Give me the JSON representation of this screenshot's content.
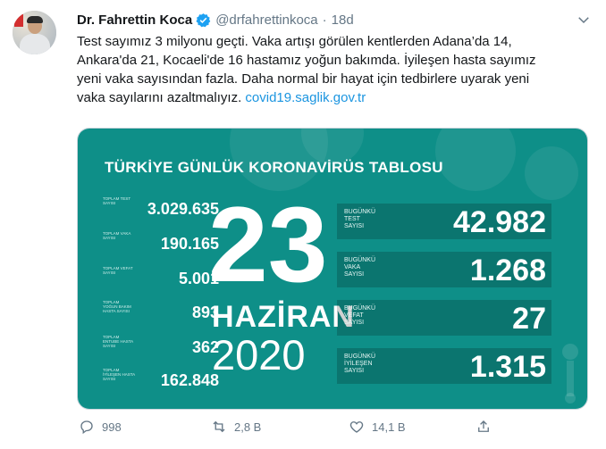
{
  "tweet": {
    "author": "Dr. Fahrettin Koca",
    "handle": "@drfahrettinkoca",
    "separator": "·",
    "time": "18d",
    "text_line1": "Test sayımız 3 milyonu geçti. Vaka artışı görülen kentlerden Adana’da 14,",
    "text_line2": "Ankara'da 21, Kocaeli'de 16 hastamız yoğun bakımda. İyileşen hasta sayımız",
    "text_line3": "yeni vaka sayısından fazla. Daha normal bir hayat için tedbirlere uyarak yeni",
    "text_line4_pre": "vaka sayılarını azaltmalıyız. ",
    "link": "covid19.saglik.gov.tr"
  },
  "image": {
    "title": "TÜRKİYE GÜNLÜK KORONAVİRÜS TABLOSU",
    "day": "23",
    "month": "HAZİRAN",
    "year": "2020",
    "left_stats": [
      {
        "label": "TOPLAM TEST SAYISI",
        "value": "3.029.635"
      },
      {
        "label": "TOPLAM VAKA SAYISI",
        "value": "190.165"
      },
      {
        "label": "TOPLAM VEFAT SAYISI",
        "value": "5.001"
      },
      {
        "label": "TOPLAM YOĞUN BAKIM HASTA SAYISI",
        "value": "893"
      },
      {
        "label": "TOPLAM ENTUBE HASTA SAYISI",
        "value": "362"
      },
      {
        "label": "TOPLAM İYİLEŞEN HASTA SAYISI",
        "value": "162.848"
      }
    ],
    "right_stats": [
      {
        "label": "BUGÜNKÜ TEST SAYISI",
        "value": "42.982"
      },
      {
        "label": "BUGÜNKÜ VAKA SAYISI",
        "value": "1.268"
      },
      {
        "label": "BUGÜNKÜ VEFAT SAYISI",
        "value": "27"
      },
      {
        "label": "BUGÜNKÜ İYİLEŞEN SAYISI",
        "value": "1.315"
      }
    ]
  },
  "actions": {
    "reply_count": "998",
    "retweet_count": "2,8 B",
    "like_count": "14,1 B"
  },
  "colors": {
    "link": "#1b95e0",
    "panel": "#0e8f88",
    "verified": "#1da1f2"
  }
}
